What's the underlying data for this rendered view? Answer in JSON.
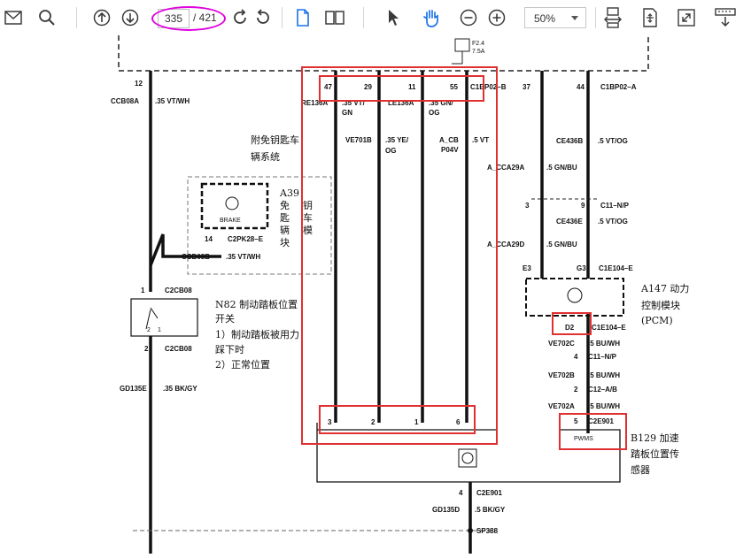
{
  "toolbar": {
    "page_current": "335",
    "page_total": "/ 421",
    "zoom_value": "50%",
    "icons": [
      "mail-icon",
      "search-icon",
      "arrow-up-circle-icon",
      "arrow-down-circle-icon",
      "rotate-cw-icon",
      "rotate-ccw-icon",
      "single-page-icon",
      "two-page-icon",
      "select-cursor-icon",
      "hand-pan-icon",
      "zoom-out-icon",
      "zoom-in-icon",
      "fit-width-icon",
      "fit-page-icon",
      "fullscreen-icon",
      "presentation-icon"
    ],
    "annotation_color": "#e000e0"
  },
  "diagram": {
    "highlight_color": "#e03030",
    "fuse_label_1": "F2.4",
    "fuse_label_2": "7.5A",
    "pin_12": "12",
    "pin_47": "47",
    "pin_29": "29",
    "pin_11": "11",
    "pin_55": "55",
    "pin_37": "37",
    "pin_44": "44",
    "conn_c1bp02b": "C1BP02–B",
    "conn_c1bp02a": "C1BP02–A",
    "wire_ccb08a": "CCB08A",
    "wire_ccb08a_spec": ".35 VT/WH",
    "wire_re136a": "RE136A",
    "wire_re136a_spec_1": ".35 VT/",
    "wire_re136a_spec_2": "GN",
    "wire_le136a": "LE136A",
    "wire_le136a_spec_1": ".35 GN/",
    "wire_le136a_spec_2": "OG",
    "wire_ve701b": "VE701B",
    "wire_ve701b_spec_1": ".35 YE/",
    "wire_ve701b_spec_2": "OG",
    "wire_acb_1": "A_CB",
    "wire_acb_2": "P04V",
    "wire_acb_spec": ".5 VT",
    "wire_ce436b": "CE436B",
    "wire_ce436b_spec": ".5 VT/OG",
    "wire_acca29a": "A_CCA29A",
    "wire_acca29a_spec": ".5 GN/BU",
    "pin_3a": "3",
    "pin_9": "9",
    "conn_c11np_a": "C11–N/P",
    "wire_ce436e": "CE436E",
    "wire_ce436e_spec": ".5 VT/OG",
    "wire_acca29d": "A_CCA29D",
    "wire_acca29d_spec": ".5 GN/BU",
    "pin_e3": "E3",
    "pin_g3": "G3",
    "conn_c1e104e_a": "C1E104–E",
    "label_immobilizer_1": "附免钥匙车",
    "label_immobilizer_2": "辆系统",
    "a39_1": "A39",
    "a39_2": "免",
    "a39_3": "钥",
    "a39_4": "匙",
    "a39_5": "车",
    "a39_6": "辆",
    "a39_7": "模",
    "a39_8": "块",
    "brake_text": "BRAKE",
    "pin_14": "14",
    "conn_c2pk28e": "C2PK28–E",
    "wire_ccb08b": "CCB08B",
    "wire_ccb08b_spec": ".35 VT/WH",
    "pin_1": "1",
    "conn_c2cb08_a": "C2CB08",
    "n82_1": "N82 制动踏板位置",
    "n82_2": "开关",
    "n82_3": "1）制动踏板被用力",
    "n82_4": "踩下时",
    "n82_5": "2）正常位置",
    "sw_2": "2",
    "sw_1": "1",
    "pin_2": "2",
    "conn_c2cb08_b": "C2CB08",
    "wire_gd135e": "GD135E",
    "wire_gd135e_spec": ".35 BK/GY",
    "a147_1": "A147 动力",
    "a147_2": "控制模块",
    "a147_3": "(PCM)",
    "pin_d2": "D2",
    "conn_c1e104e_b": "C1E104–E",
    "wire_ve702c": "VE702C",
    "wire_ve702c_spec": ".5 BU/WH",
    "pin_4a": "4",
    "conn_c11np_b": "C11–N/P",
    "wire_ve702b": "VE702B",
    "wire_ve702b_spec": ".5 BU/WH",
    "pin_2b": "2",
    "conn_c12ab": "C12–A/B",
    "wire_ve702a": "VE702A",
    "wire_ve702a_spec": ".5 BU/WH",
    "pin_5": "5",
    "conn_c2e901_a": "C2E901",
    "pwms": "PWMS",
    "pin_3b": "3",
    "pin_2c": "2",
    "pin_1b": "1",
    "pin_6": "6",
    "b129_1": "B129 加速",
    "b129_2": "踏板位置传",
    "b129_3": "感器",
    "pin_4b": "4",
    "conn_c2e901_b": "C2E901",
    "wire_gd135d": "GD135D",
    "wire_gd135d_spec": ".5 BK/GY",
    "splice_sp388": "SP388"
  }
}
